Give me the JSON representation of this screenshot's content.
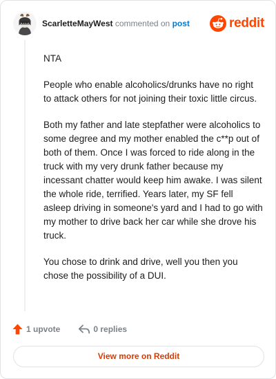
{
  "header": {
    "username": "ScarletteMayWest",
    "action_text": "commented on",
    "post_link": "post",
    "brand_name": "reddit"
  },
  "comment": {
    "paragraphs": [
      "NTA",
      "People who enable alcoholics/drunks have no right to attack others for not joining their toxic little circus.",
      "Both my father and late stepfather were alcoholics to some degree and my mother enabled the c**p out of both of them. Once I was forced to ride along in the truck with my very drunk father because my incessant chatter would keep him awake. I was silent the whole ride, terrified. Years later, my SF fell asleep driving in someone's yard and I had to go with my mother to drive back her car while she drove his truck.",
      "You chose to drink and drive, well you then you chose the possibility of a DUI."
    ]
  },
  "actions": {
    "upvote_label": "1 upvote",
    "replies_label": "0 replies"
  },
  "footer": {
    "view_more_label": "View more on Reddit"
  },
  "icons": {
    "upvote": "upvote-arrow-icon",
    "reply": "reply-arrow-icon",
    "brand": "reddit-snoo-icon",
    "avatar": "snoo-avatar"
  },
  "colors": {
    "brand": "#ff4500",
    "link": "#0079d3",
    "view_more": "#d93a00",
    "muted": "#7c8287"
  }
}
